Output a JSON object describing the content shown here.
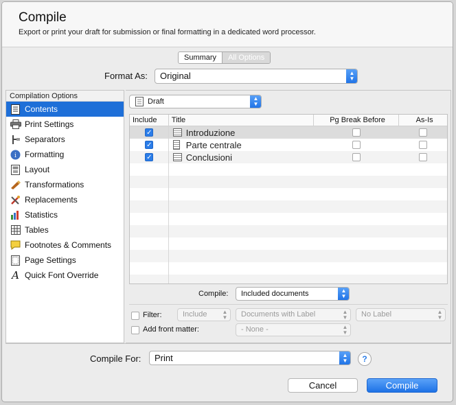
{
  "header": {
    "title": "Compile",
    "subtitle": "Export or print your draft for submission or final formatting in a dedicated word processor."
  },
  "tabs": {
    "summary": "Summary",
    "all_options": "All Options"
  },
  "format_as": {
    "label": "Format As:",
    "value": "Original"
  },
  "sidebar": {
    "heading": "Compilation Options",
    "items": [
      {
        "label": "Contents",
        "icon": "contents-icon"
      },
      {
        "label": "Print Settings",
        "icon": "printer-icon"
      },
      {
        "label": "Separators",
        "icon": "separators-icon"
      },
      {
        "label": "Formatting",
        "icon": "formatting-icon"
      },
      {
        "label": "Layout",
        "icon": "layout-icon"
      },
      {
        "label": "Transformations",
        "icon": "transformations-icon"
      },
      {
        "label": "Replacements",
        "icon": "replacements-icon"
      },
      {
        "label": "Statistics",
        "icon": "statistics-icon"
      },
      {
        "label": "Tables",
        "icon": "tables-icon"
      },
      {
        "label": "Footnotes & Comments",
        "icon": "footnotes-icon"
      },
      {
        "label": "Page Settings",
        "icon": "page-settings-icon"
      },
      {
        "label": "Quick Font Override",
        "icon": "font-icon"
      }
    ]
  },
  "contents": {
    "folder": "Draft",
    "columns": {
      "include": "Include",
      "title": "Title",
      "pg_break": "Pg Break Before",
      "as_is": "As-Is"
    },
    "rows": [
      {
        "title": "Introduzione",
        "include": true,
        "pg_break": false,
        "as_is": false
      },
      {
        "title": "Parte centrale",
        "include": true,
        "pg_break": false,
        "as_is": false
      },
      {
        "title": "Conclusioni",
        "include": true,
        "pg_break": false,
        "as_is": false
      }
    ],
    "compile_label": "Compile:",
    "compile_value": "Included documents",
    "filter_label": "Filter:",
    "filter_mode": "Include",
    "filter_by": "Documents with Label",
    "filter_label_value": "No Label",
    "front_matter_label": "Add front matter:",
    "front_matter_value": "- None -"
  },
  "compile_for": {
    "label": "Compile For:",
    "value": "Print"
  },
  "buttons": {
    "cancel": "Cancel",
    "compile": "Compile",
    "help": "?"
  },
  "colors": {
    "accent": "#1e6fd8",
    "primary_button": "#2b7de8"
  }
}
